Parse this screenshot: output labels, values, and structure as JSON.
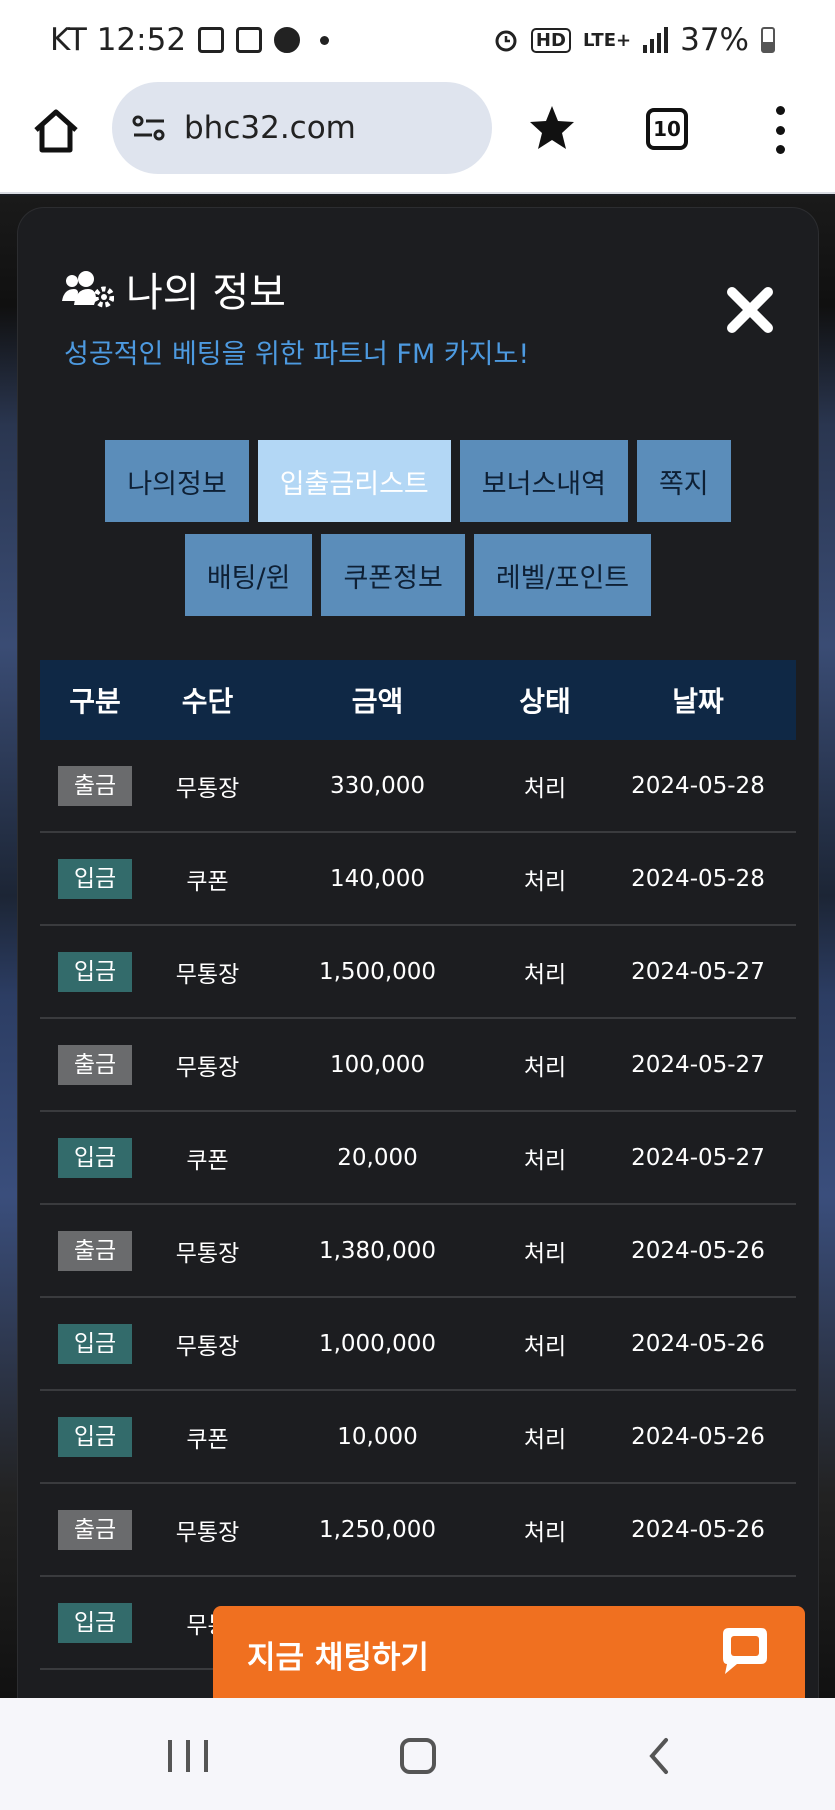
{
  "status_bar": {
    "time": "KT 12:52",
    "lte": "LTE+",
    "hd": "HD",
    "battery": "37%"
  },
  "browser": {
    "url": "bhc32.com",
    "tab_count": "10"
  },
  "modal": {
    "title": "나의 정보",
    "subtitle": "성공적인 베팅을 위한 파트너 FM 카지노!",
    "tabs": [
      {
        "label": "나의정보",
        "active": false
      },
      {
        "label": "입출금리스트",
        "active": true
      },
      {
        "label": "보너스내역",
        "active": false
      },
      {
        "label": "쪽지",
        "active": false
      },
      {
        "label": "배팅/윈",
        "active": false
      },
      {
        "label": "쿠폰정보",
        "active": false
      },
      {
        "label": "레벨/포인트",
        "active": false
      }
    ],
    "table": {
      "headers": [
        "구분",
        "수단",
        "금액",
        "상태",
        "날짜"
      ],
      "rows": [
        {
          "type": "출금",
          "method": "무통장",
          "amount": "330,000",
          "status": "처리",
          "date": "2024-05-28"
        },
        {
          "type": "입금",
          "method": "쿠폰",
          "amount": "140,000",
          "status": "처리",
          "date": "2024-05-28"
        },
        {
          "type": "입금",
          "method": "무통장",
          "amount": "1,500,000",
          "status": "처리",
          "date": "2024-05-27"
        },
        {
          "type": "출금",
          "method": "무통장",
          "amount": "100,000",
          "status": "처리",
          "date": "2024-05-27"
        },
        {
          "type": "입금",
          "method": "쿠폰",
          "amount": "20,000",
          "status": "처리",
          "date": "2024-05-27"
        },
        {
          "type": "출금",
          "method": "무통장",
          "amount": "1,380,000",
          "status": "처리",
          "date": "2024-05-26"
        },
        {
          "type": "입금",
          "method": "무통장",
          "amount": "1,000,000",
          "status": "처리",
          "date": "2024-05-26"
        },
        {
          "type": "입금",
          "method": "쿠폰",
          "amount": "10,000",
          "status": "처리",
          "date": "2024-05-26"
        },
        {
          "type": "출금",
          "method": "무통장",
          "amount": "1,250,000",
          "status": "처리",
          "date": "2024-05-26"
        },
        {
          "type": "입금",
          "method": "무통",
          "amount": "",
          "status": "",
          "date": ""
        }
      ]
    }
  },
  "chat": {
    "label": "지금 채팅하기"
  },
  "colors": {
    "accent_blue": "#4d9ae0",
    "tab_bg": "#5b8dba",
    "tab_active_bg": "#b3d7f5",
    "header_bg": "#0f2845",
    "badge_out": "#6a6b6d",
    "badge_in": "#336b6b",
    "chat_orange": "#f07020"
  }
}
